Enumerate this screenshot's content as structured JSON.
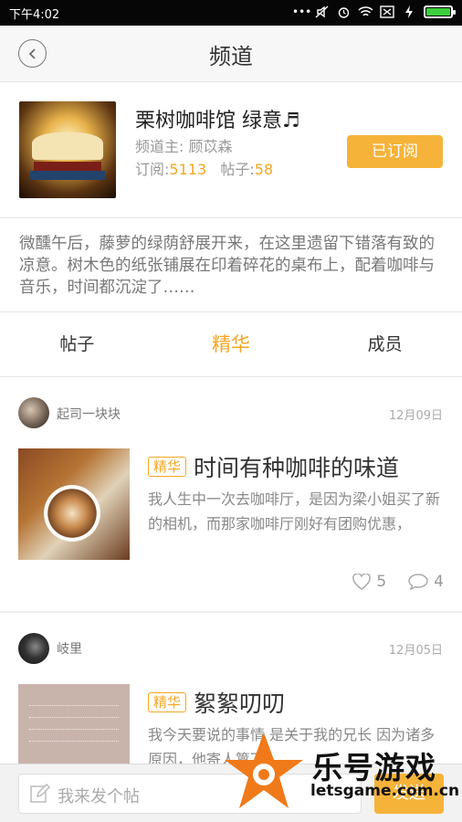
{
  "status_bar": {
    "time": "下午4:02",
    "battery_color": "#3ccf3c"
  },
  "header": {
    "title": "频道",
    "back_icon": "chevron-left-icon"
  },
  "channel": {
    "name": "栗树咖啡馆   绿意♬",
    "owner": "频道主: 顾苡森",
    "subscribe_label": "订阅:",
    "subscribe_count": "5113",
    "posts_label": "帖子:",
    "posts_count": "58",
    "subscribed_button": "已订阅",
    "description": "微醺午后，藤萝的绿荫舒展开来，在这里遗留下错落有致的凉意。树木色的纸张铺展在印着碎花的桌布上，配着咖啡与音乐，时间都沉淀了……"
  },
  "tabs": [
    {
      "label": "帖子",
      "active": false
    },
    {
      "label": "精华",
      "active": true
    },
    {
      "label": "成员",
      "active": false
    }
  ],
  "posts": [
    {
      "author": "起司一块块",
      "date": "12月09日",
      "badge": "精华",
      "title": "时间有种咖啡的味道",
      "excerpt": "我人生中一次去咖啡厅，是因为梁小姐买了新的相机，而那家咖啡厅刚好有团购优惠，",
      "likes": "5",
      "comments": "4"
    },
    {
      "author": "岐里",
      "date": "12月05日",
      "badge": "精华",
      "title": "絮絮叨叨",
      "excerpt": "我今天要说的事情 是关于我的兄长 因为诸多原因，他寄人篱下"
    }
  ],
  "composer": {
    "placeholder": "我来发个帖",
    "send_label": "发送"
  },
  "watermark": {
    "cn": "乐号游戏",
    "en": "letsgame.com.cn"
  },
  "colors": {
    "accent": "#f5a623",
    "button": "#f6b33a"
  }
}
